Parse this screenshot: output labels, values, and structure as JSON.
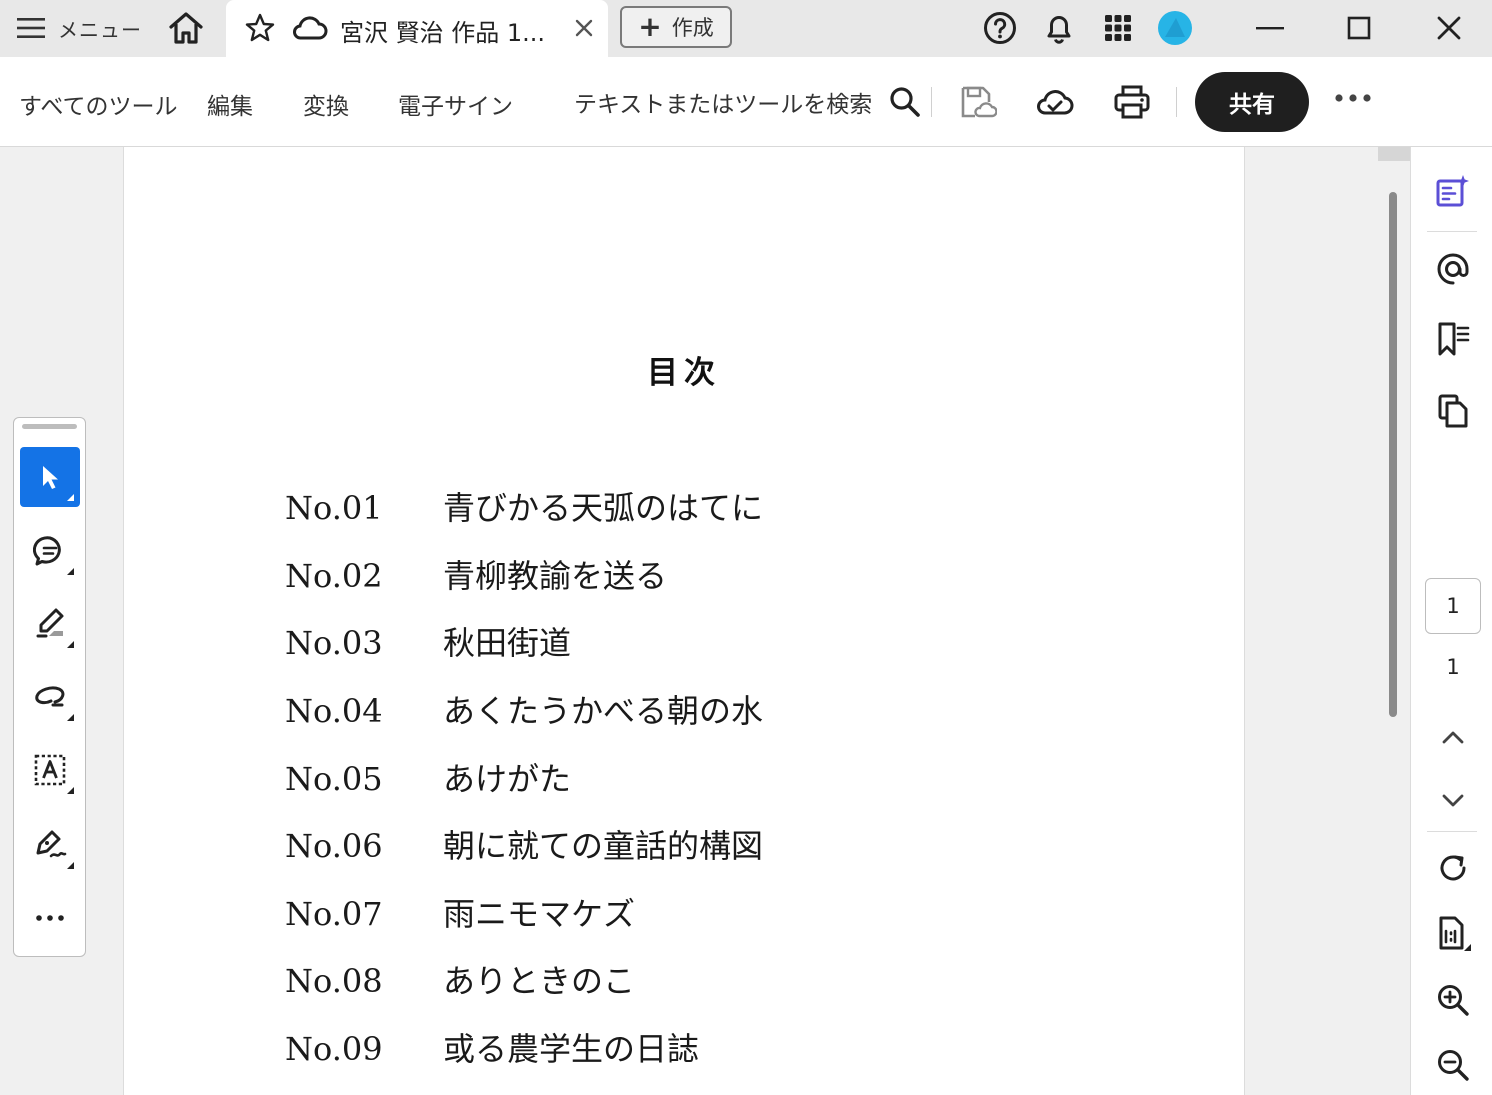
{
  "titlebar": {
    "menu_label": "メニュー",
    "tab_title": "宮沢 賢治 作品 1...",
    "create_label": "作成",
    "create_plus": "+",
    "tab_close": "×"
  },
  "toolbar": {
    "nav": [
      "すべてのツール",
      "編集",
      "変換",
      "電子サイン"
    ],
    "search_placeholder": "テキストまたはツールを検索",
    "share_label": "共有"
  },
  "document": {
    "heading": "目次",
    "entries": [
      {
        "num": "No.01",
        "title": "青びかる天弧のはてに"
      },
      {
        "num": "No.02",
        "title": "青柳教諭を送る"
      },
      {
        "num": "No.03",
        "title": "秋田街道"
      },
      {
        "num": "No.04",
        "title": "あくたうかべる朝の水"
      },
      {
        "num": "No.05",
        "title": "あけがた"
      },
      {
        "num": "No.06",
        "title": "朝に就ての童話的構図"
      },
      {
        "num": "No.07",
        "title": "雨ニモマケズ"
      },
      {
        "num": "No.08",
        "title": "ありときのこ"
      },
      {
        "num": "No.09",
        "title": "或る農学生の日誌"
      }
    ]
  },
  "right_panel": {
    "current_page": "1",
    "total_pages": "1"
  },
  "left_tools": {
    "more_label": "..."
  },
  "colors": {
    "accent": "#1473e6",
    "share_bg": "#1f1f1f",
    "ai_icon": "#5b4fd6"
  }
}
